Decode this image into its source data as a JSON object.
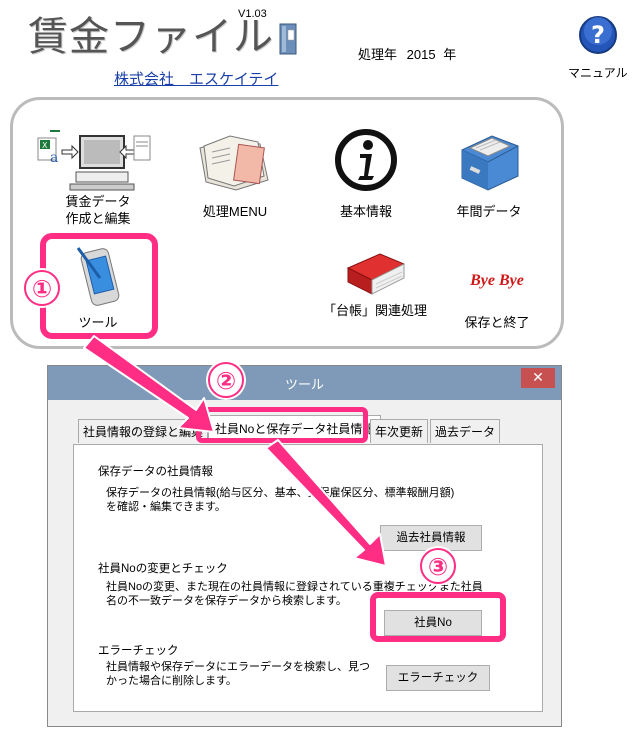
{
  "header": {
    "app_title": "賃金ファイル",
    "version": "V1.03",
    "company": "株式会社　エスケイテイ",
    "year_label": "処理年",
    "year_value": "2015",
    "year_suffix": "年",
    "manual_label": "マニュアル"
  },
  "menu": {
    "items": [
      {
        "label_line1": "賃金データ",
        "label_line2": "作成と編集"
      },
      {
        "label_line1": "処理MENU"
      },
      {
        "label_line1": "基本情報"
      },
      {
        "label_line1": "年間データ"
      },
      {
        "label_line1": "ツール"
      },
      {
        "label_line1": "「台帳」関連処理"
      },
      {
        "label_line1": "保存と終了",
        "logo_text": "Bye Bye"
      }
    ]
  },
  "steps": [
    "①",
    "②",
    "③"
  ],
  "dialog": {
    "title": "ツール",
    "close": "✕",
    "tabs": [
      "社員情報の登録と編集",
      "社員Noと保存データ社員情報",
      "年次更新",
      "過去データ"
    ],
    "sections": [
      {
        "title": "保存データの社員情報",
        "desc_line1": "保存データの社員情報(給与区分、基本、労保雇保区分、標準報酬月額)",
        "desc_line2": "を確認・編集できます。",
        "button": "過去社員情報"
      },
      {
        "title": "社員Noの変更とチェック",
        "desc_line1": "社員Noの変更、また現在の社員情報に登録されている重複チェックまた社員",
        "desc_line2": "名の不一致データを保存データから検索します。",
        "button": "社員No"
      },
      {
        "title": "エラーチェック",
        "desc_line1": "社員情報や保存データにエラーデータを検索し、見つ",
        "desc_line2": "かった場合に削除します。",
        "button": "エラーチェック"
      }
    ]
  },
  "colors": {
    "highlight": "#ff2d84",
    "link": "#1a3fa8",
    "titlebar": "#7f9ab8",
    "close": "#c75050"
  }
}
